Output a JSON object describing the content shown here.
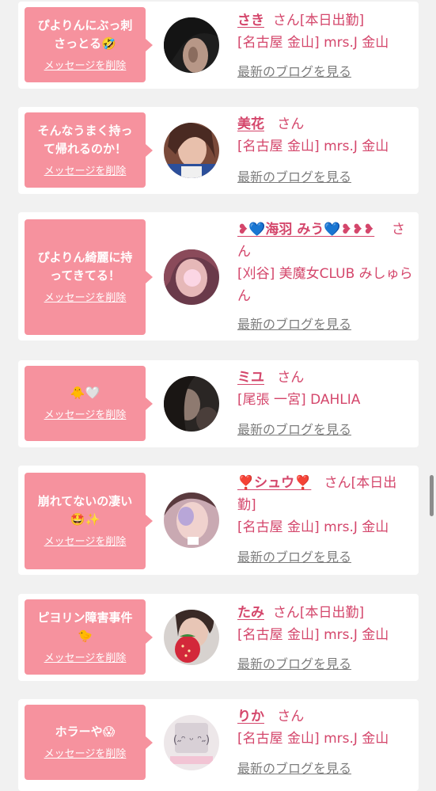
{
  "common": {
    "delete_label": "メッセージを削除",
    "san_label": "さん",
    "blog_label": "最新のブログを見る"
  },
  "colors": {
    "page_bg": "#f1f1f1",
    "bubble": "#f6929e",
    "accent": "#d4466b",
    "link_gray": "#7d7d7d"
  },
  "items": [
    {
      "message": "ぴよりんにぶっ刺\nさっとる🤣",
      "name": "さき",
      "status": "[本日出勤]",
      "shop": "[名古屋 金山] mrs.J 金山"
    },
    {
      "message": "そんなうまく持っ\nて帰れるのか！",
      "name": "美花",
      "status": "",
      "shop": "[名古屋 金山] mrs.J 金山"
    },
    {
      "message": "ぴよりん綺麗に持\nってきてる！",
      "name": "❥💙海羽 みう💙❥❥❥",
      "status": "",
      "shop": "[刈谷] 美魔女CLUB みしゅらん"
    },
    {
      "message": "🐥🤍",
      "name": "ミユ",
      "status": "",
      "shop": "[尾張 一宮] DAHLIA"
    },
    {
      "message": "崩れてないの凄い\n🤩✨",
      "name": "❣️シュウ❣️",
      "status": "[本日出勤]",
      "shop": "[名古屋 金山] mrs.J 金山"
    },
    {
      "message": "ピヨリン障害事件\n🐤",
      "name": "たみ",
      "status": "[本日出勤]",
      "shop": "[名古屋 金山] mrs.J 金山"
    },
    {
      "message": "ホラーや😱",
      "name": "りか",
      "status": "",
      "shop": "[名古屋 金山] mrs.J 金山"
    }
  ]
}
